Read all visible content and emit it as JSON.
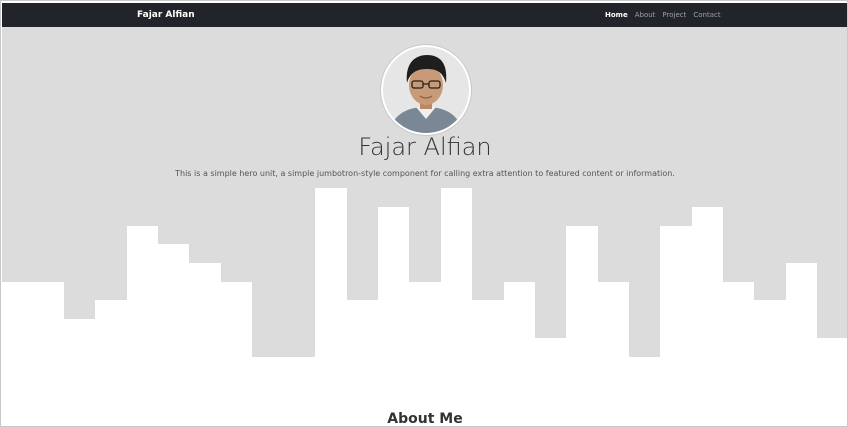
{
  "navbar": {
    "brand": "Fajar Alfian",
    "links": [
      "Home",
      "About",
      "Project",
      "Contact"
    ]
  },
  "hero": {
    "title": "Fajar Alfian",
    "subtitle": "This is a simple hero unit, a simple jumbotron-style component for calling extra attention to featured content or information."
  },
  "about": {
    "heading": "About Me"
  },
  "colors": {
    "navbar": "#212529",
    "hero_bg": "#dcdcdc",
    "skyline": "#ffffff"
  }
}
